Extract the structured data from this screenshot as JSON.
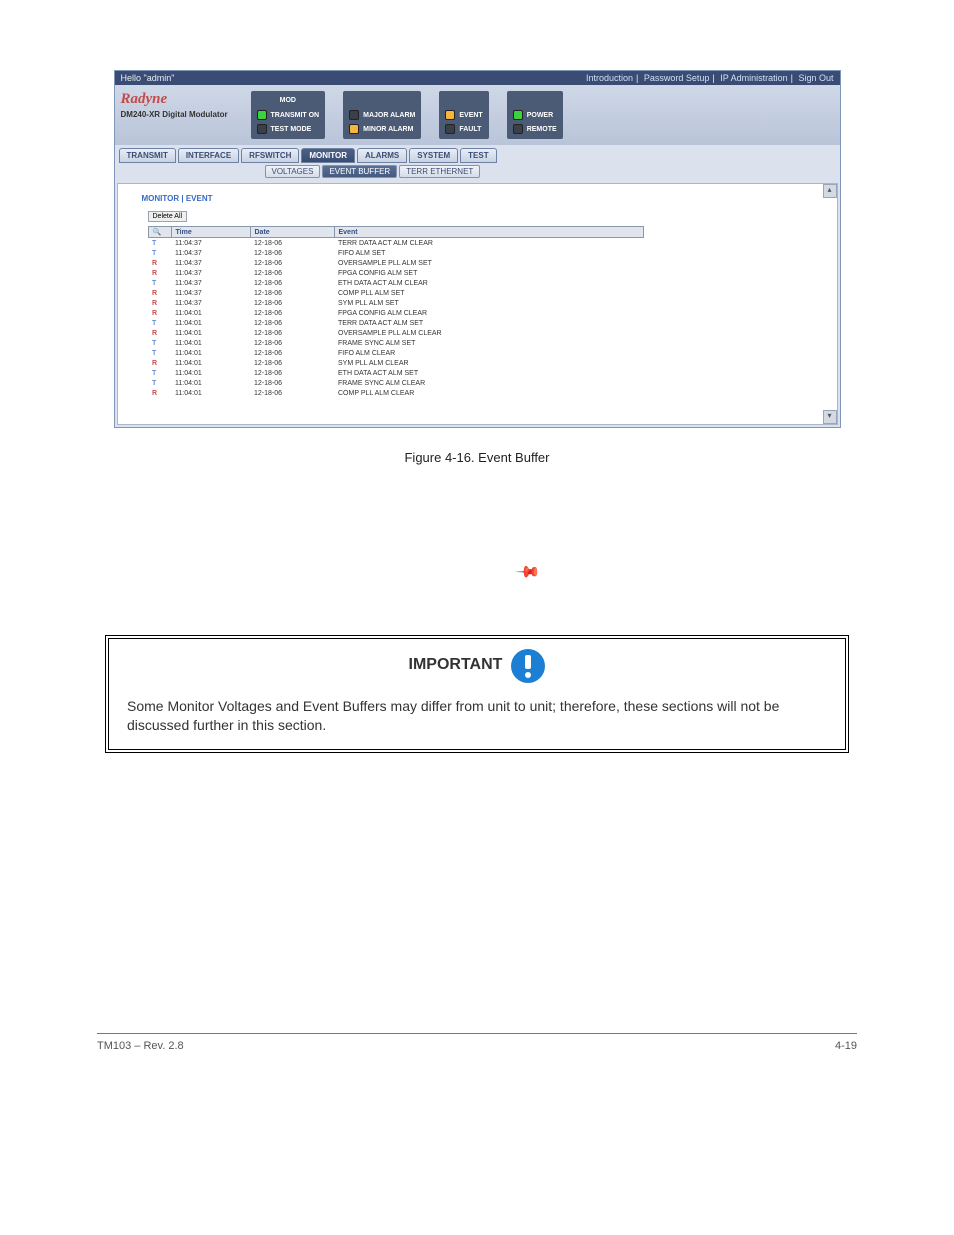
{
  "top": {
    "hello": "Hello \"admin\"",
    "links": [
      "Introduction",
      "Password Setup",
      "IP Administration",
      "Sign Out"
    ]
  },
  "brand": {
    "name": "Radyne",
    "product": "DM240-XR Digital Modulator"
  },
  "led_groups": [
    {
      "title": "MOD",
      "rows": [
        {
          "color": "green",
          "label": "TRANSMIT ON"
        },
        {
          "color": "off",
          "label": "TEST MODE"
        }
      ]
    },
    {
      "title": "",
      "rows": [
        {
          "color": "off",
          "label": "MAJOR ALARM"
        },
        {
          "color": "orange",
          "label": "MINOR ALARM"
        }
      ]
    },
    {
      "title": "",
      "rows": [
        {
          "color": "orange",
          "label": "EVENT"
        },
        {
          "color": "off",
          "label": "FAULT"
        }
      ]
    },
    {
      "title": "",
      "rows": [
        {
          "color": "green",
          "label": "POWER"
        },
        {
          "color": "off",
          "label": "REMOTE"
        }
      ]
    }
  ],
  "tabs": {
    "main": [
      "TRANSMIT",
      "INTERFACE",
      "RFSWITCH",
      "MONITOR",
      "ALARMS",
      "SYSTEM",
      "TEST"
    ],
    "main_active": "MONITOR",
    "sub": [
      "VOLTAGES",
      "EVENT BUFFER",
      "TERR ETHERNET"
    ],
    "sub_active": "EVENT BUFFER"
  },
  "crumb": "MONITOR | EVENT",
  "delete_label": "Delete All",
  "columns": {
    "time": "Time",
    "date": "Date",
    "event": "Event"
  },
  "events": [
    {
      "m": "T",
      "time": "11:04:37",
      "date": "12-18-06",
      "event": "TERR DATA ACT ALM CLEAR"
    },
    {
      "m": "T",
      "time": "11:04:37",
      "date": "12-18-06",
      "event": "FIFO ALM SET"
    },
    {
      "m": "R",
      "time": "11:04:37",
      "date": "12-18-06",
      "event": "OVERSAMPLE PLL ALM SET"
    },
    {
      "m": "R",
      "time": "11:04:37",
      "date": "12-18-06",
      "event": "FPGA CONFIG ALM SET"
    },
    {
      "m": "T",
      "time": "11:04:37",
      "date": "12-18-06",
      "event": "ETH DATA ACT ALM CLEAR"
    },
    {
      "m": "R",
      "time": "11:04:37",
      "date": "12-18-06",
      "event": "COMP PLL ALM SET"
    },
    {
      "m": "R",
      "time": "11:04:37",
      "date": "12-18-06",
      "event": "SYM PLL ALM SET"
    },
    {
      "m": "R",
      "time": "11:04:01",
      "date": "12-18-06",
      "event": "FPGA CONFIG ALM CLEAR"
    },
    {
      "m": "T",
      "time": "11:04:01",
      "date": "12-18-06",
      "event": "TERR DATA ACT ALM SET"
    },
    {
      "m": "R",
      "time": "11:04:01",
      "date": "12-18-06",
      "event": "OVERSAMPLE PLL ALM CLEAR"
    },
    {
      "m": "T",
      "time": "11:04:01",
      "date": "12-18-06",
      "event": "FRAME SYNC ALM SET"
    },
    {
      "m": "T",
      "time": "11:04:01",
      "date": "12-18-06",
      "event": "FIFO ALM CLEAR"
    },
    {
      "m": "R",
      "time": "11:04:01",
      "date": "12-18-06",
      "event": "SYM PLL ALM CLEAR"
    },
    {
      "m": "T",
      "time": "11:04:01",
      "date": "12-18-06",
      "event": "ETH DATA ACT ALM SET"
    },
    {
      "m": "T",
      "time": "11:04:01",
      "date": "12-18-06",
      "event": "FRAME SYNC ALM CLEAR"
    },
    {
      "m": "R",
      "time": "11:04:01",
      "date": "12-18-06",
      "event": "COMP PLL ALM CLEAR"
    }
  ],
  "caption": "Figure 4-16. Event Buffer",
  "important": {
    "head": "IMPORTANT",
    "body": "Some Monitor Voltages and Event Buffers may differ from unit to unit; therefore, these sections will not be discussed further in this section."
  },
  "footer": {
    "left": "TM103 – Rev. 2.8",
    "right": "4-19"
  }
}
